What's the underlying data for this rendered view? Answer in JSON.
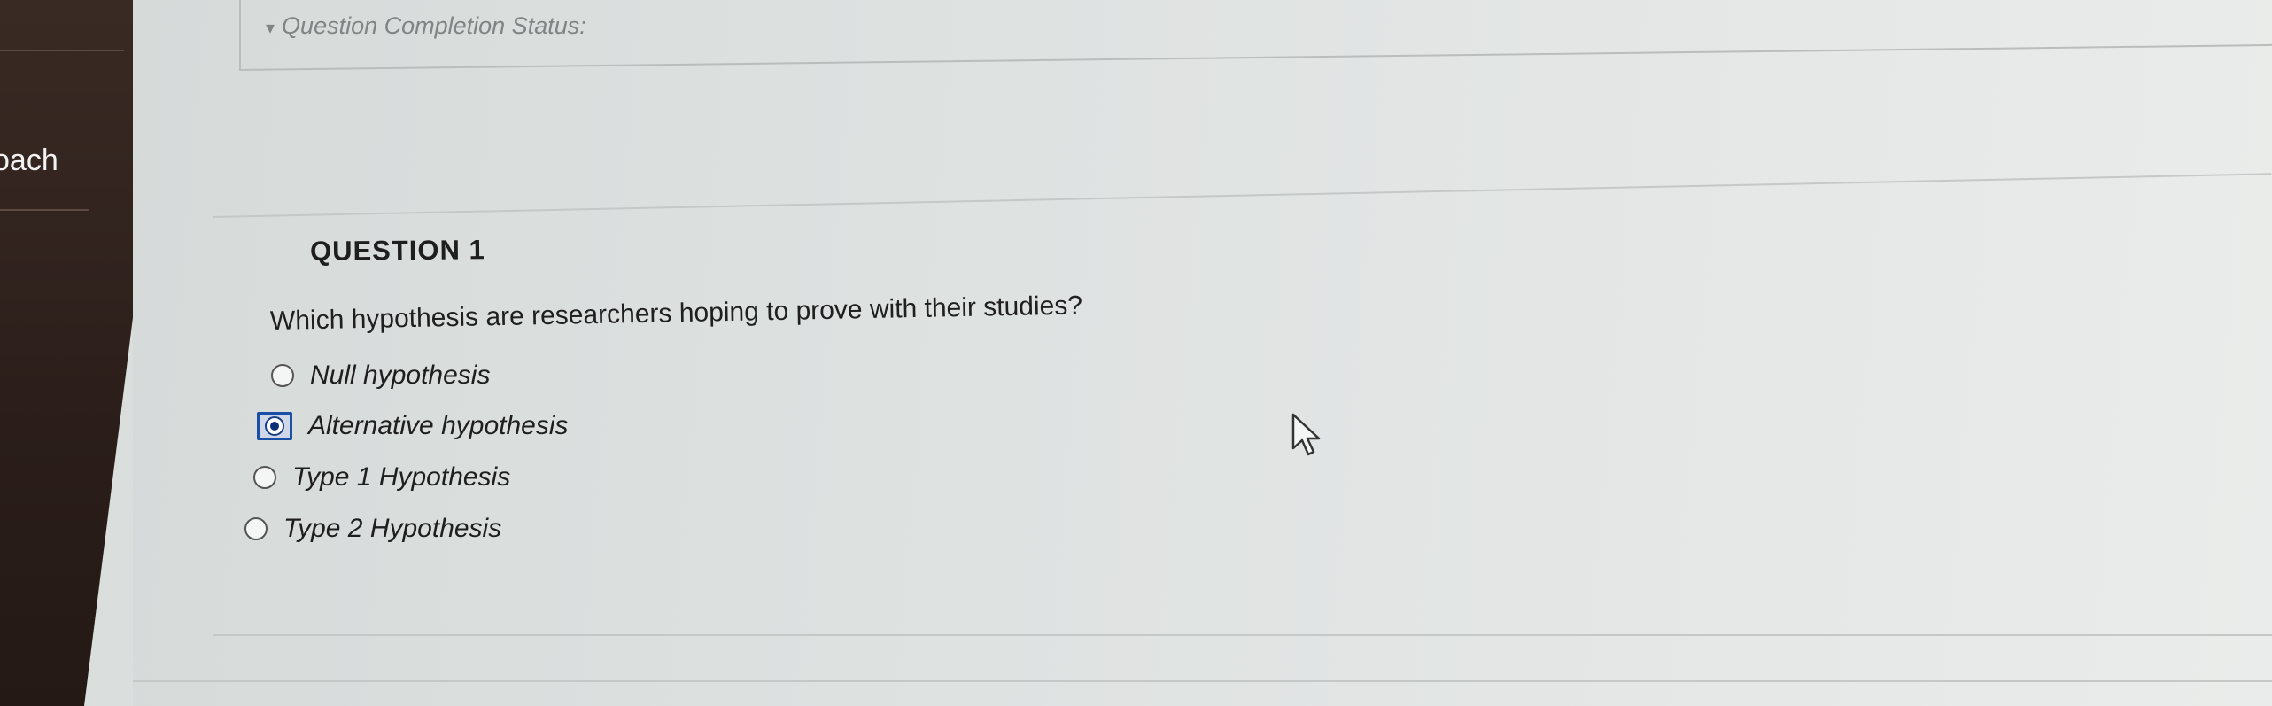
{
  "sidebar": {
    "visible_label": "oach"
  },
  "status": {
    "icon": "chevron-down-icon",
    "icon_glyph": "▾",
    "label": "Question Completion Status:"
  },
  "question": {
    "title": "QUESTION 1",
    "text": "Which hypothesis are researchers hoping to prove with their studies?",
    "options": [
      {
        "label": "Null hypothesis",
        "selected": false
      },
      {
        "label": "Alternative hypothesis",
        "selected": true
      },
      {
        "label": "Type 1 Hypothesis",
        "selected": false
      },
      {
        "label": "Type 2 Hypothesis",
        "selected": false
      }
    ]
  },
  "colors": {
    "selected_accent": "#1a4fa8",
    "sidebar_bg": "#2b1e1a"
  }
}
